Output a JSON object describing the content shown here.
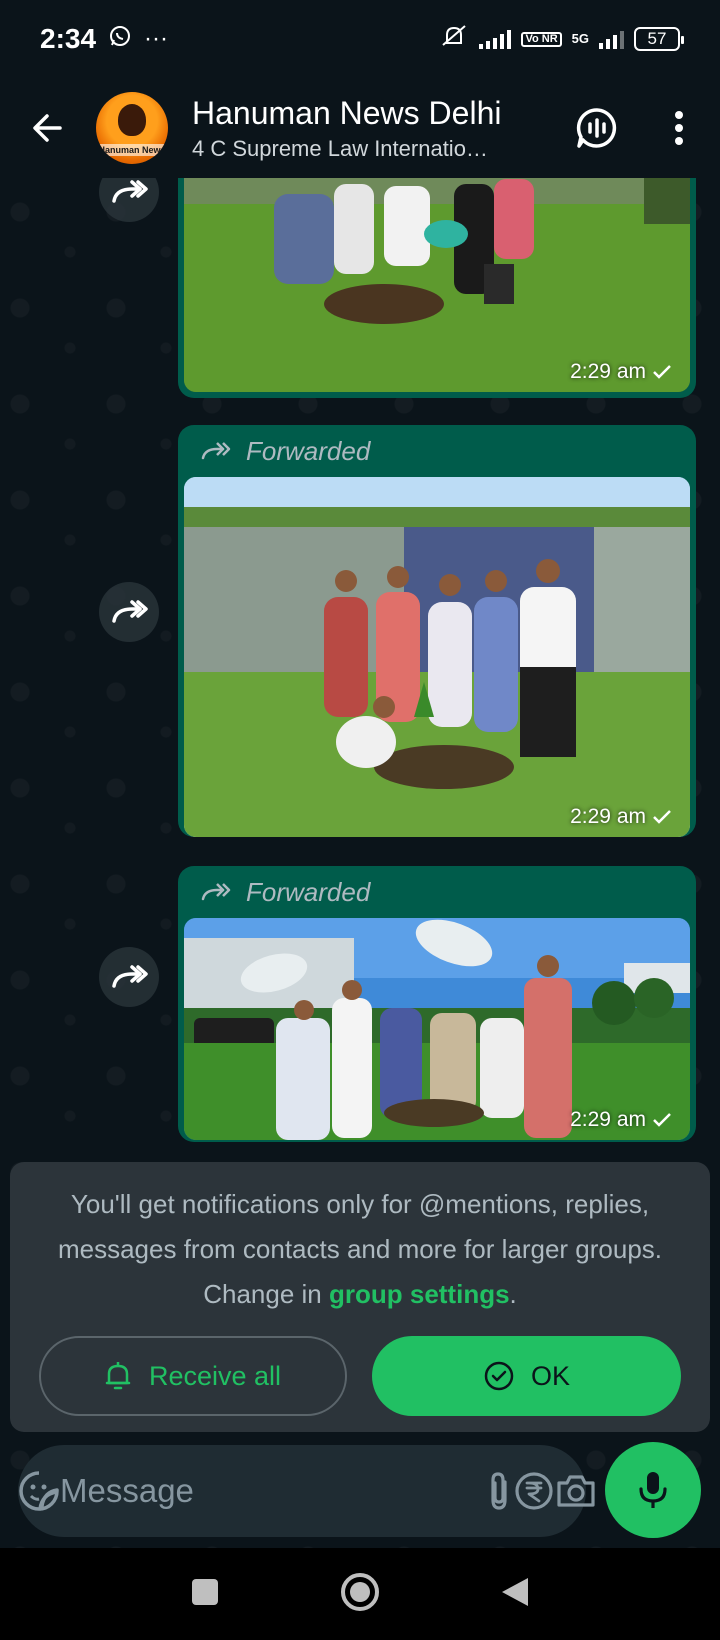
{
  "status_bar": {
    "time": "2:34",
    "network": "5G",
    "volte": "Vo NR",
    "battery": "57"
  },
  "header": {
    "title": "Hanuman News Delhi",
    "subtitle": "4 C Supreme Law Internatio…",
    "avatar_text": "Hanuman News",
    "icons": [
      "back-arrow-icon",
      "voice-chat-icon",
      "more-vert-icon"
    ]
  },
  "messages": [
    {
      "type": "image",
      "forwarded": false,
      "time": "2:29 am",
      "status": "sent",
      "scene": "people planting a sapling, cropped at top"
    },
    {
      "type": "image",
      "forwarded": true,
      "forwarded_label": "Forwarded",
      "time": "2:29 am",
      "status": "sent",
      "scene": "group of seven men posing by a wall while one plants a tree"
    },
    {
      "type": "image",
      "forwarded": true,
      "forwarded_label": "Forwarded",
      "time": "2:29 am",
      "status": "sent",
      "scene": "men planting a tree near satellite dishes"
    }
  ],
  "notice": {
    "text_before": "You'll get notifications only for @mentions, replies, messages from contacts and more for larger groups. Change in ",
    "link": "group settings",
    "text_after": ".",
    "receive_all_label": "Receive all",
    "ok_label": "OK"
  },
  "composer": {
    "placeholder": "Message"
  },
  "colors": {
    "background": "#0b141a",
    "bubble_out": "#005c4b",
    "accent": "#21c063",
    "card": "#2c343a"
  }
}
